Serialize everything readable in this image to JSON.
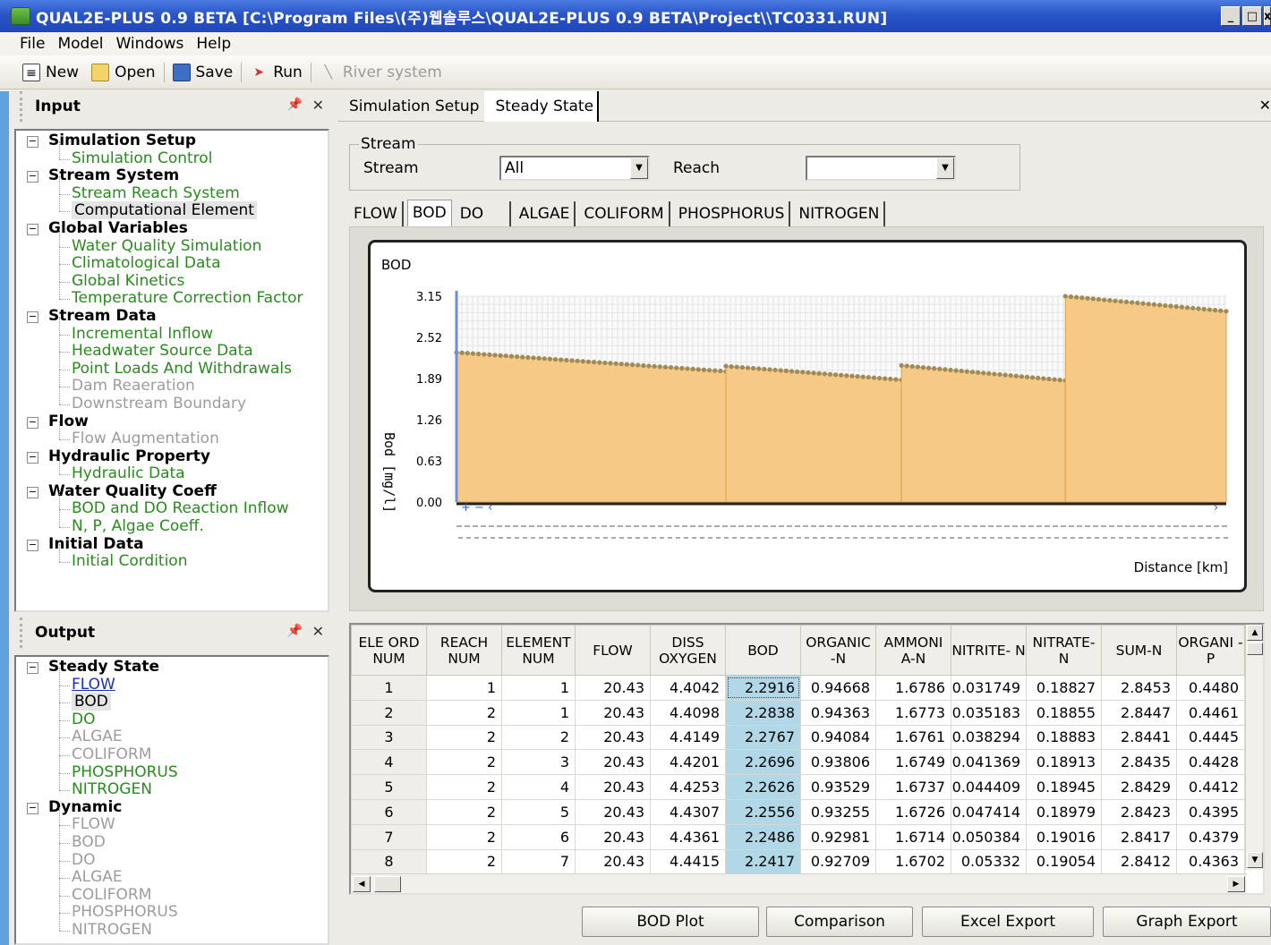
{
  "window": {
    "title": "QUAL2E-PLUS 0.9 BETA  [C:\\Program Files\\(주)웹솔루스\\QUAL2E-PLUS 0.9 BETA\\Project\\\\TC0331.RUN]",
    "controls": [
      "_",
      "□",
      "x"
    ]
  },
  "menu": [
    "File",
    "Model",
    "Windows",
    "Help"
  ],
  "toolbar": {
    "new": "New",
    "open": "Open",
    "save": "Save",
    "run": "Run",
    "river": "River system"
  },
  "input_panel": {
    "title": "Input",
    "tree": [
      {
        "label": "Simulation Setup",
        "children": [
          {
            "label": "Simulation Control",
            "state": "green"
          }
        ]
      },
      {
        "label": "Stream System",
        "children": [
          {
            "label": "Stream Reach System",
            "state": "green"
          },
          {
            "label": "Computational Element",
            "state": "selected"
          }
        ]
      },
      {
        "label": "Global Variables",
        "children": [
          {
            "label": "Water Quality Simulation",
            "state": "green"
          },
          {
            "label": "Climatological Data",
            "state": "green"
          },
          {
            "label": "Global Kinetics",
            "state": "green"
          },
          {
            "label": "Temperature Correction Factor",
            "state": "green"
          }
        ]
      },
      {
        "label": "Stream Data",
        "children": [
          {
            "label": "Incremental Inflow",
            "state": "green"
          },
          {
            "label": "Headwater Source Data",
            "state": "green"
          },
          {
            "label": "Point Loads And Withdrawals",
            "state": "green"
          },
          {
            "label": "Dam Reaeration",
            "state": "grey"
          },
          {
            "label": "Downstream Boundary",
            "state": "grey"
          }
        ]
      },
      {
        "label": "Flow",
        "children": [
          {
            "label": "Flow Augmentation",
            "state": "grey"
          }
        ]
      },
      {
        "label": "Hydraulic Property",
        "children": [
          {
            "label": "Hydraulic Data",
            "state": "green"
          }
        ]
      },
      {
        "label": "Water Quality Coeff",
        "children": [
          {
            "label": "BOD and DO Reaction Inflow",
            "state": "green"
          },
          {
            "label": "N, P, Algae Coeff.",
            "state": "green"
          }
        ]
      },
      {
        "label": "Initial Data",
        "children": [
          {
            "label": "Initial Cordition",
            "state": "green"
          }
        ]
      }
    ]
  },
  "output_panel": {
    "title": "Output",
    "tree": [
      {
        "label": "Steady State",
        "children": [
          {
            "label": "FLOW",
            "state": "link"
          },
          {
            "label": "BOD",
            "state": "selected"
          },
          {
            "label": "DO",
            "state": "green"
          },
          {
            "label": "ALGAE",
            "state": "grey"
          },
          {
            "label": "COLIFORM",
            "state": "grey"
          },
          {
            "label": "PHOSPHORUS",
            "state": "green"
          },
          {
            "label": "NITROGEN",
            "state": "green"
          }
        ]
      },
      {
        "label": "Dynamic",
        "children": [
          {
            "label": "FLOW",
            "state": "grey"
          },
          {
            "label": "BOD",
            "state": "grey"
          },
          {
            "label": "DO",
            "state": "grey"
          },
          {
            "label": "ALGAE",
            "state": "grey"
          },
          {
            "label": "COLIFORM",
            "state": "grey"
          },
          {
            "label": "PHOSPHORUS",
            "state": "grey"
          },
          {
            "label": "NITROGEN",
            "state": "grey"
          }
        ]
      }
    ]
  },
  "doc_tabs": [
    "Simulation Setup",
    "Steady State"
  ],
  "stream_group": {
    "legend": "Stream",
    "stream_label": "Stream",
    "stream_value": "All",
    "reach_label": "Reach",
    "reach_value": ""
  },
  "result_tabs": [
    "FLOW",
    "BOD",
    "DO",
    "ALGAE",
    "COLIFORM",
    "PHOSPHORUS",
    "NITROGEN"
  ],
  "active_result_tab": "BOD",
  "chart_data": {
    "type": "area",
    "title": "BOD",
    "ylabel": "Bod [mg/l]",
    "xlabel": "Distance [km]",
    "yticks": [
      "3.15",
      "2.52",
      "1.89",
      "1.26",
      "0.63",
      "0.00"
    ],
    "ylim": [
      0,
      3.15
    ],
    "grid": true,
    "fill_color": "#f7c987",
    "marker_color": "#a08a56",
    "segments": [
      {
        "values": [
          2.29,
          2.0
        ]
      },
      {
        "values": [
          2.08,
          1.87
        ]
      },
      {
        "values": [
          2.09,
          1.86
        ]
      },
      {
        "values": [
          3.15,
          2.92
        ]
      }
    ]
  },
  "table": {
    "headers": [
      "ELE ORD NUM",
      "REACH NUM",
      "ELEMENT NUM",
      "FLOW",
      "DISS OXYGEN",
      "BOD",
      "ORGANIC -N",
      "AMMONI A-N",
      "NITRITE- N",
      "NITRATE- N",
      "SUM-N",
      "ORGANI -P"
    ],
    "rows": [
      [
        "1",
        "1",
        "1",
        "20.43",
        "4.4042",
        "2.2916",
        "0.94668",
        "1.6786",
        "0.031749",
        "0.18827",
        "2.8453",
        "0.4480"
      ],
      [
        "2",
        "2",
        "1",
        "20.43",
        "4.4098",
        "2.2838",
        "0.94363",
        "1.6773",
        "0.035183",
        "0.18855",
        "2.8447",
        "0.4461"
      ],
      [
        "3",
        "2",
        "2",
        "20.43",
        "4.4149",
        "2.2767",
        "0.94084",
        "1.6761",
        "0.038294",
        "0.18883",
        "2.8441",
        "0.4445"
      ],
      [
        "4",
        "2",
        "3",
        "20.43",
        "4.4201",
        "2.2696",
        "0.93806",
        "1.6749",
        "0.041369",
        "0.18913",
        "2.8435",
        "0.4428"
      ],
      [
        "5",
        "2",
        "4",
        "20.43",
        "4.4253",
        "2.2626",
        "0.93529",
        "1.6737",
        "0.044409",
        "0.18945",
        "2.8429",
        "0.4412"
      ],
      [
        "6",
        "2",
        "5",
        "20.43",
        "4.4307",
        "2.2556",
        "0.93255",
        "1.6726",
        "0.047414",
        "0.18979",
        "2.8423",
        "0.4395"
      ],
      [
        "7",
        "2",
        "6",
        "20.43",
        "4.4361",
        "2.2486",
        "0.92981",
        "1.6714",
        "0.050384",
        "0.19016",
        "2.8417",
        "0.4379"
      ],
      [
        "8",
        "2",
        "7",
        "20.43",
        "4.4415",
        "2.2417",
        "0.92709",
        "1.6702",
        "0.05332",
        "0.19054",
        "2.8412",
        "0.4363"
      ]
    ]
  },
  "buttons": {
    "bod_plot": "BOD Plot",
    "comparison": "Comparison",
    "excel_export": "Excel Export",
    "graph_export": "Graph Export"
  }
}
